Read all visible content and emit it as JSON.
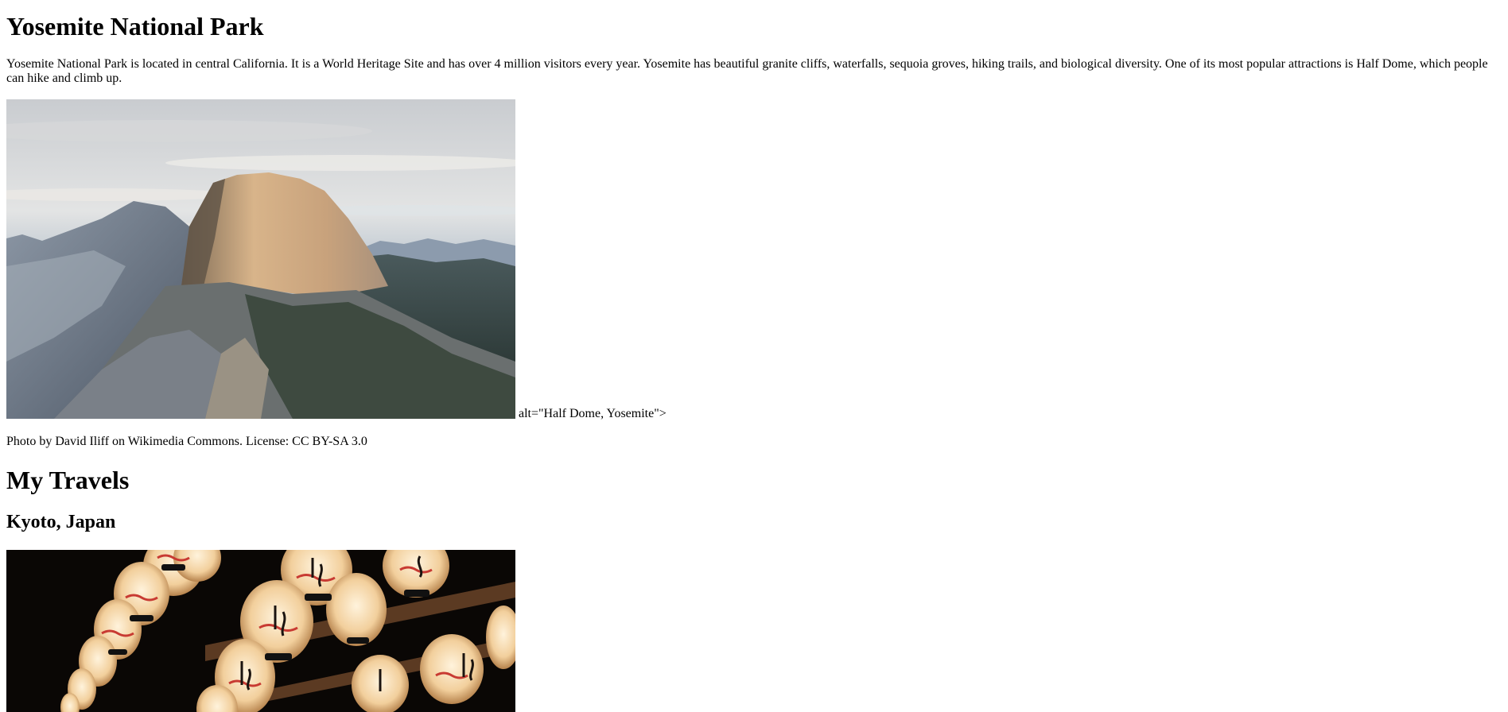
{
  "page": {
    "title": "Yosemite National Park",
    "intro": "Yosemite National Park is located in central California. It is a World Heritage Site and has over 4 million visitors every year. Yosemite has beautiful granite cliffs, waterfalls, sequoia groves, hiking trails, and biological diversity. One of its most popular attractions is Half Dome, which people can hike and climb up.",
    "yosemite_alt_text": "alt=\"Half Dome, Yosemite\">",
    "photo_credit": "Photo by David Iliff on Wikimedia Commons. License: CC BY-SA 3.0",
    "travels_heading": "My Travels",
    "kyoto_heading": "Kyoto, Japan"
  },
  "images": {
    "half_dome": "half-dome-photo",
    "kyoto_lanterns": "kyoto-lanterns-photo"
  }
}
